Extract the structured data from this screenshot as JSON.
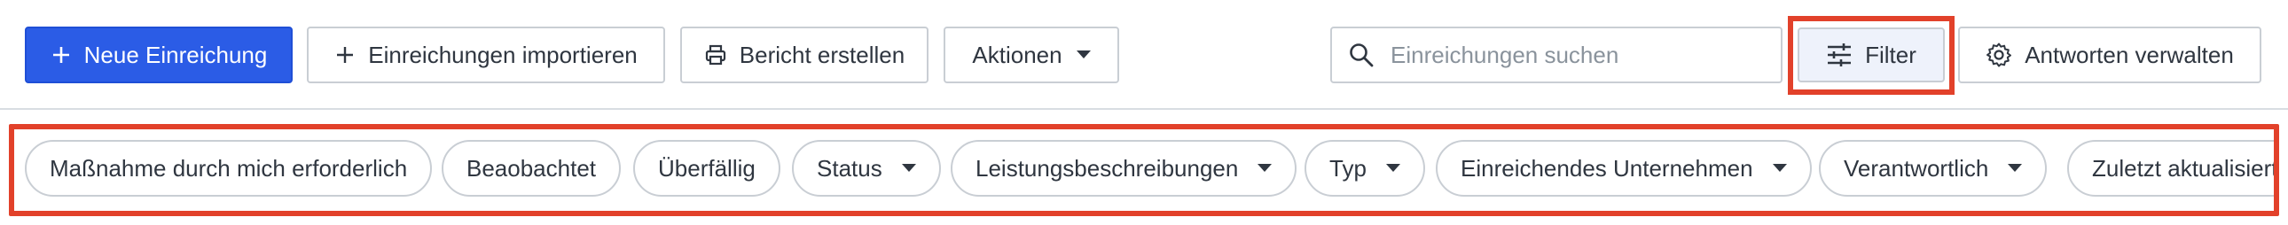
{
  "toolbar": {
    "new_submission_label": "Neue Einreichung",
    "import_label": "Einreichungen importieren",
    "report_label": "Bericht erstellen",
    "actions_label": "Aktionen",
    "search_placeholder": "Einreichungen suchen",
    "filter_label": "Filter",
    "manage_responses_label": "Antworten verwalten"
  },
  "filters": {
    "chips": [
      {
        "label": "Maßnahme durch mich erforderlich",
        "dropdown": false
      },
      {
        "label": "Beaobachtet",
        "dropdown": false
      },
      {
        "label": "Überfällig",
        "dropdown": false
      },
      {
        "label": "Status",
        "dropdown": true
      },
      {
        "label": "Leistungsbeschreibungen",
        "dropdown": true
      },
      {
        "label": "Typ",
        "dropdown": true
      },
      {
        "label": "Einreichendes Unternehmen",
        "dropdown": true
      },
      {
        "label": "Verantwortlich",
        "dropdown": true
      },
      {
        "label": "Zuletzt aktualisiert",
        "dropdown": true
      }
    ]
  },
  "colors": {
    "primary": "#2b5ce6",
    "highlight": "#e2412a",
    "border": "#c9ced4"
  },
  "icons": {
    "new": "plus-icon",
    "import": "plus-icon",
    "report": "printer-icon",
    "actions": "caret-down-icon",
    "search": "search-icon",
    "filter": "sliders-icon",
    "manage": "gear-icon"
  }
}
